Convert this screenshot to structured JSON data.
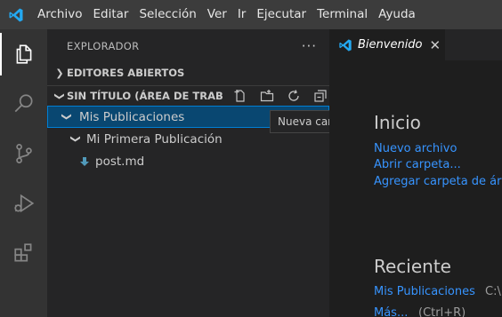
{
  "menu": [
    "Archivo",
    "Editar",
    "Selección",
    "Ver",
    "Ir",
    "Ejecutar",
    "Terminal",
    "Ayuda"
  ],
  "sidebar": {
    "title": "EXPLORADOR",
    "more": "···",
    "section_open_editors": "EDITORES ABIERTOS",
    "section_workspace": "SIN TÍTULO (ÁREA DE TRAB...",
    "tree": {
      "folder1": "Mis Publicaciones",
      "folder2": "Mi Primera Publicación",
      "file1": "post.md"
    }
  },
  "tooltip": "Nueva carpeta",
  "tab": {
    "label": "Bienvenido",
    "close": "✕"
  },
  "welcome": {
    "start_heading": "Inicio",
    "new_file": "Nuevo archivo",
    "open_folder": "Abrir carpeta...",
    "add_workspace_folder": "Agregar carpeta de área",
    "recent_heading": "Reciente",
    "recent_item": "Mis Publicaciones",
    "recent_path": "C:\\",
    "more": "Más...",
    "more_shortcut": "(Ctrl+R)"
  },
  "colors": {
    "accent": "#007acc",
    "link": "#3794ff",
    "selection": "#094771"
  }
}
